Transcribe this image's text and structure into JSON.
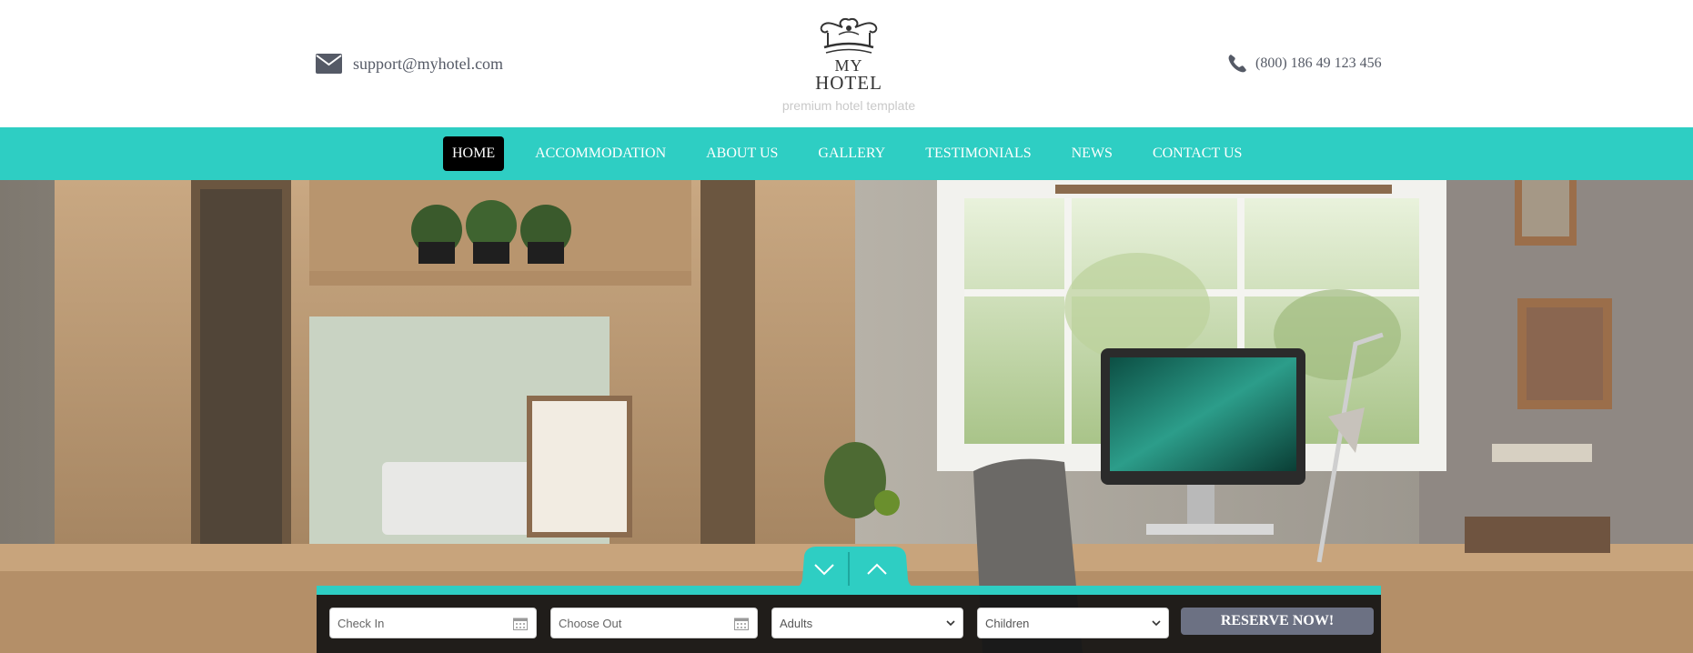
{
  "header": {
    "email": "support@myhotel.com",
    "email_icon": "envelope-icon",
    "phone": "(800) 186 49 123 456",
    "phone_icon": "phone-icon",
    "logo": {
      "line1": "MY",
      "line2": "HOTEL",
      "tagline": "premium hotel template"
    }
  },
  "nav": {
    "items": [
      {
        "label": "HOME",
        "active": true
      },
      {
        "label": "ACCOMMODATION"
      },
      {
        "label": "ABOUT US"
      },
      {
        "label": "GALLERY"
      },
      {
        "label": "TESTIMONIALS"
      },
      {
        "label": "NEWS"
      },
      {
        "label": "CONTACT US"
      }
    ]
  },
  "booking": {
    "check_in_placeholder": "Check In",
    "check_out_placeholder": "Choose Out",
    "adults": "Adults",
    "children": "Children",
    "reserve_label": "RESERVE NOW!",
    "toggle_down_icon": "chevron-down-icon",
    "toggle_up_icon": "chevron-up-icon"
  },
  "colors": {
    "accent": "#2ecec3",
    "active_nav": "#000000",
    "reserve_button": "#6c7183",
    "text": "#555a66"
  }
}
